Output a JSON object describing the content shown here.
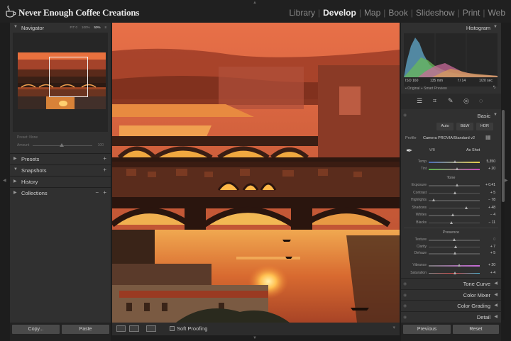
{
  "app": {
    "brand": "Never Enough Coffee Creations",
    "modules": [
      "Library",
      "Develop",
      "Map",
      "Book",
      "Slideshow",
      "Print",
      "Web"
    ],
    "active_module": "Develop"
  },
  "left_panel": {
    "navigator": {
      "title": "Navigator",
      "zoom_options": [
        "FIT 0",
        "100%",
        "50%",
        "8"
      ],
      "active_zoom": "50%"
    },
    "preset_label": "Preset: None",
    "amount_label": "Amount",
    "amount_value": "100",
    "sections": [
      {
        "label": "Presets",
        "action": "+"
      },
      {
        "label": "Snapshots",
        "action": "+"
      },
      {
        "label": "History",
        "action": ""
      },
      {
        "label": "Collections",
        "action": "+",
        "action2": "−"
      }
    ],
    "copy_button": "Copy...",
    "paste_button": "Paste"
  },
  "toolbar": {
    "soft_proofing_label": "Soft Proofing"
  },
  "right_panel": {
    "histogram_title": "Histogram",
    "histogram_meta": [
      "ISO 160",
      "135 mm",
      "f / 14",
      "1/20 sec"
    ],
    "preview_label": "Original + Smart Preview",
    "basic_title": "Basic",
    "treatment_buttons": [
      "Auto",
      "B&W",
      "HDR"
    ],
    "profile_label": "Profile",
    "profile_value": "Camera PROVIA/Standard v2",
    "wb_label": "WB",
    "wb_value": "As Shot",
    "tone_group": "Tone",
    "presence_group": "Presence",
    "color_sliders": [
      {
        "name": "Temp",
        "value": "5,350",
        "pos": 0.52,
        "track": "temp"
      },
      {
        "name": "Tint",
        "value": "+ 20",
        "pos": 0.56,
        "track": "tint"
      }
    ],
    "tone_sliders": [
      {
        "name": "Exposure",
        "value": "+ 0.41",
        "pos": 0.56
      },
      {
        "name": "Contrast",
        "value": "+ 5",
        "pos": 0.52
      },
      {
        "name": "Highlights",
        "value": "− 78",
        "pos": 0.11
      },
      {
        "name": "Shadows",
        "value": "+ 48",
        "pos": 0.74
      },
      {
        "name": "Whites",
        "value": "− 4",
        "pos": 0.48
      },
      {
        "name": "Blacks",
        "value": "− 11",
        "pos": 0.45
      }
    ],
    "presence_sliders": [
      {
        "name": "Texture",
        "value": "0",
        "pos": 0.5,
        "dim": true
      },
      {
        "name": "Clarity",
        "value": "+ 7",
        "pos": 0.54
      },
      {
        "name": "Dehaze",
        "value": "+ 5",
        "pos": 0.52
      }
    ],
    "vibrance_sliders": [
      {
        "name": "Vibrance",
        "value": "+ 20",
        "pos": 0.6,
        "track": "vib"
      },
      {
        "name": "Saturation",
        "value": "+ 4",
        "pos": 0.52,
        "track": "sat"
      }
    ],
    "collapsed_panels": [
      "Tone Curve",
      "Color Mixer",
      "Color Grading",
      "Detail"
    ],
    "previous_button": "Previous",
    "reset_button": "Reset"
  },
  "colors": {
    "panel": "#303030",
    "topbar": "#202020",
    "active_text": "#f0f0f0"
  }
}
